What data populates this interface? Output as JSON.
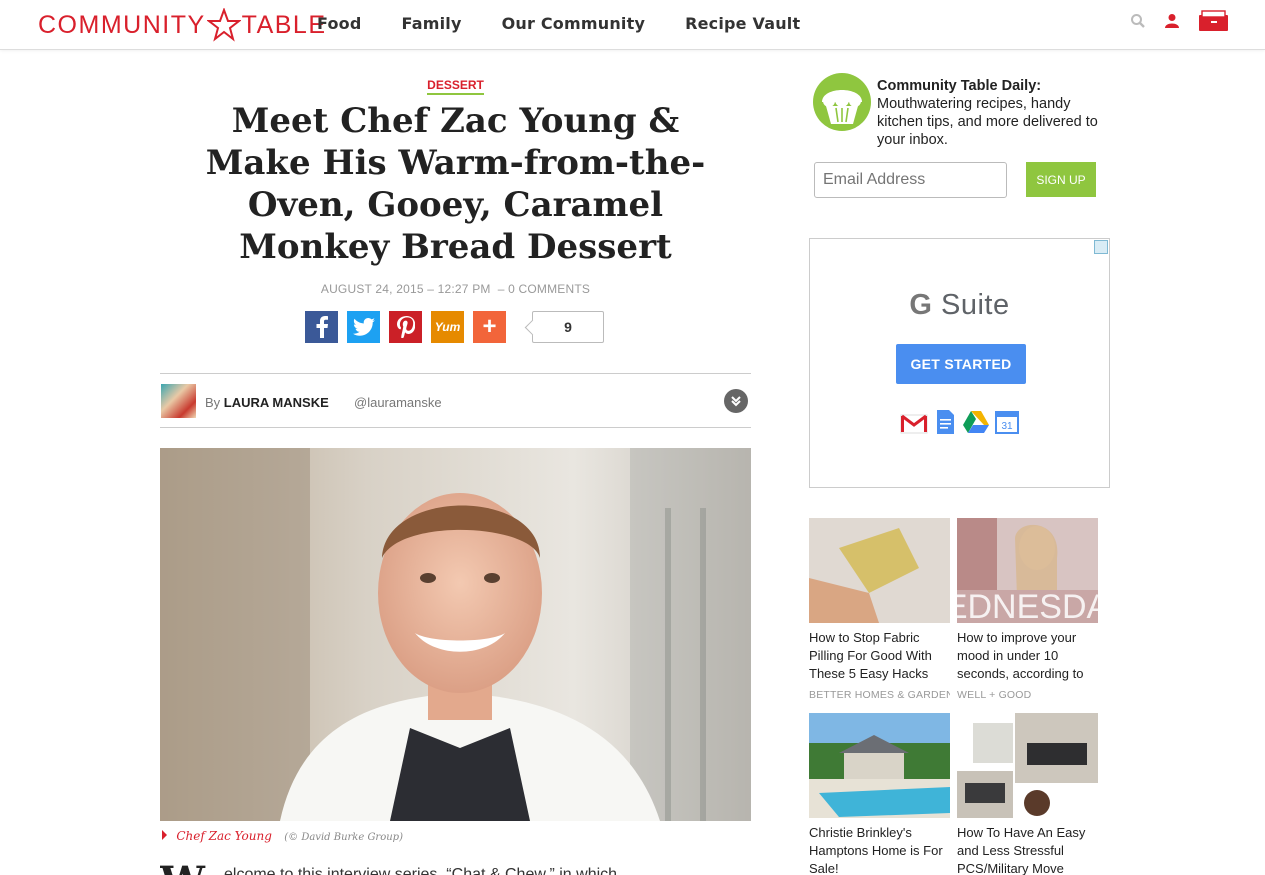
{
  "header": {
    "logo_left": "COMMUNITY",
    "logo_right": "TABLE",
    "nav": [
      "Food",
      "Family",
      "Our Community",
      "Recipe Vault"
    ],
    "icons": [
      "search-icon",
      "user-icon",
      "recipe-box-icon"
    ]
  },
  "article": {
    "category": "DESSERT",
    "title": "Meet Chef Zac Young & Make His Warm-from-the-Oven, Gooey, Caramel Monkey Bread Dessert",
    "date": "AUGUST 24, 2015 – 12:27 PM",
    "comments": "0 COMMENTS",
    "share_count": "9",
    "yum_label": "Yum",
    "author_prefix": "By",
    "author_name": "LAURA MANSKE",
    "author_handle": "@lauramanske",
    "caption_name": "Chef Zac Young",
    "caption_credit": "(© David Burke Group)",
    "body_dropcap": "W",
    "body_start": "elcome to this interview series, “Chat & Chew,” in which"
  },
  "sidebar": {
    "newsletter": {
      "title": "Community Table Daily:",
      "text": "Mouthwatering recipes, handy kitchen tips, and more delivered to your inbox.",
      "email_placeholder": "Email Address",
      "signup_label": "SIGN UP"
    },
    "ad": {
      "brand_g": "G",
      "brand_rest": " Suite",
      "cta": "GET STARTED",
      "calendar_day": "31"
    },
    "recommended": [
      {
        "title": "How to Stop Fabric Pilling For Good With These 5 Easy Hacks",
        "source": "BETTER HOMES & GARDENS"
      },
      {
        "title": "How to improve your mood in under 10 seconds, according to",
        "source": "WELL + GOOD"
      },
      {
        "title": "Christie Brinkley's Hamptons Home is For Sale!",
        "source": ""
      },
      {
        "title": "How To Have An Easy and Less Stressful PCS/Military Move",
        "source": ""
      }
    ]
  },
  "colors": {
    "brand_red": "#d9202c",
    "accent_green": "#8fc63f",
    "facebook": "#3b5998",
    "twitter": "#1da1f2",
    "pinterest": "#cb2027",
    "yummly": "#e68a00",
    "addthis": "#f2653a",
    "ad_cta": "#4a8ef0"
  }
}
